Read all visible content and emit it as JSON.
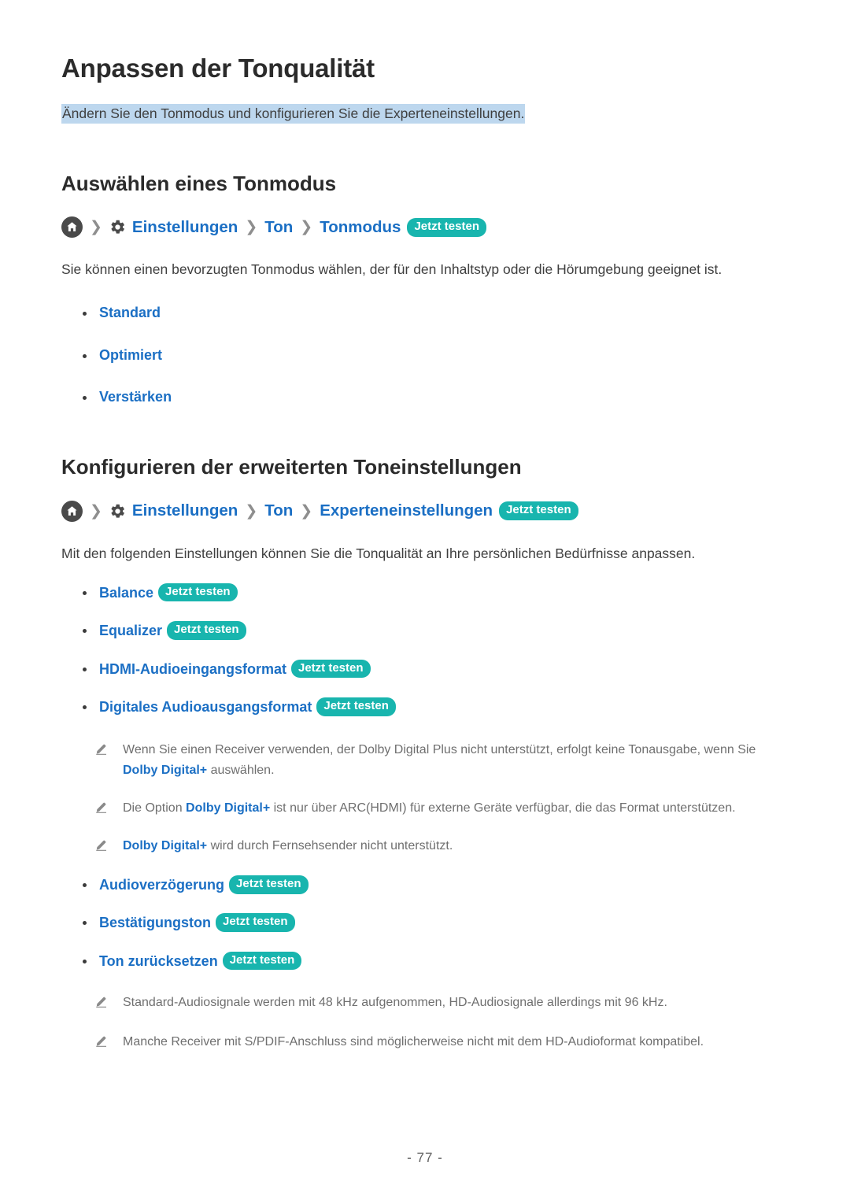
{
  "document": {
    "title": "Anpassen der Tonqualität",
    "subtitle": "Ändern Sie den Tonmodus und konfigurieren Sie die Experteneinstellungen.",
    "page_number": "- 77 -"
  },
  "colors": {
    "link_blue": "#1b6fc4",
    "badge_teal": "#18b5ae",
    "highlight_blue": "#bdd7ee",
    "note_gray": "#6f6f6f",
    "heading_dark": "#2b2b2b"
  },
  "labels": {
    "try_now": "Jetzt testen",
    "separator": "〉"
  },
  "sections": [
    {
      "heading": "Auswählen eines Tonmodus",
      "breadcrumb": {
        "home_icon": "home-icon",
        "gear_icon": "gear-icon",
        "items": [
          "Einstellungen",
          "Ton",
          "Tonmodus"
        ],
        "badge": "Jetzt testen"
      },
      "intro": "Sie können einen bevorzugten Tonmodus wählen, der für den Inhaltstyp oder die Hörumgebung geeignet ist.",
      "items": [
        {
          "label": "Standard",
          "badge": ""
        },
        {
          "label": "Optimiert",
          "badge": ""
        },
        {
          "label": "Verstärken",
          "badge": ""
        }
      ]
    },
    {
      "heading": "Konfigurieren der erweiterten Toneinstellungen",
      "breadcrumb": {
        "home_icon": "home-icon",
        "gear_icon": "gear-icon",
        "items": [
          "Einstellungen",
          "Ton",
          "Experteneinstellungen"
        ],
        "badge": "Jetzt testen"
      },
      "intro": "Mit den folgenden Einstellungen können Sie die Tonqualität an Ihre persönlichen Bedürfnisse anpassen.",
      "items": [
        {
          "label": "Balance",
          "badge": "Jetzt testen"
        },
        {
          "label": "Equalizer",
          "badge": "Jetzt testen"
        },
        {
          "label": "HDMI-Audioeingangsformat",
          "badge": "Jetzt testen"
        },
        {
          "label": "Digitales Audioausgangsformat",
          "badge": "Jetzt testen"
        }
      ],
      "notes_group_1": [
        {
          "pre": "Wenn Sie einen Receiver verwenden, der Dolby Digital Plus nicht unterstützt, erfolgt keine Tonausgabe, wenn Sie ",
          "strong": "Dolby Digital+",
          "post": " auswählen."
        },
        {
          "pre": "Die Option ",
          "strong": "Dolby Digital+",
          "post": " ist nur über ARC(HDMI) für externe Geräte verfügbar, die das Format unterstützen."
        },
        {
          "pre": "",
          "strong": "Dolby Digital+",
          "post": " wird durch Fernsehsender nicht unterstützt."
        }
      ],
      "items_2": [
        {
          "label": "Audioverzögerung",
          "badge": "Jetzt testen"
        },
        {
          "label": "Bestätigungston",
          "badge": "Jetzt testen"
        },
        {
          "label": "Ton zurücksetzen",
          "badge": "Jetzt testen"
        }
      ],
      "notes_group_2": [
        {
          "pre": "Standard-Audiosignale werden mit 48 kHz aufgenommen, HD-Audiosignale allerdings mit 96 kHz.",
          "strong": "",
          "post": ""
        },
        {
          "pre": "Manche Receiver mit S/PDIF-Anschluss sind möglicherweise nicht mit dem HD-Audioformat kompatibel.",
          "strong": "",
          "post": ""
        }
      ]
    }
  ]
}
